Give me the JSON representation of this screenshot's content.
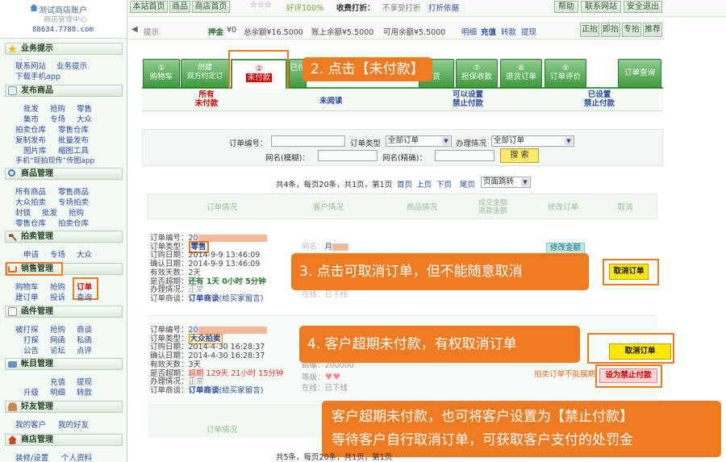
{
  "sidebar": {
    "logo_title": "测试商店账户",
    "logo_subtitle": "商店管理中心",
    "logo_url": "88634.7788.com",
    "sections": [
      {
        "title": "业务提示",
        "links": [
          "联系网站",
          "业务提示",
          "下载手机app"
        ]
      },
      {
        "title": "发布商品",
        "links": [
          "批发",
          "抢购",
          "零售",
          "集市",
          "专场",
          "大众",
          "拍卖仓库",
          "零售仓库",
          "复制发布",
          "批量发布",
          "图片库",
          "缩图工具",
          "手机“现拍现传”传图app"
        ]
      },
      {
        "title": "商品管理",
        "links": [
          "所有商品",
          "零售商品",
          "大众拍卖",
          "专场拍卖",
          "封锁",
          "批发",
          "抢购",
          "零售仓库",
          "拍卖仓库"
        ]
      },
      {
        "title": "拍卖管理",
        "links": [
          "申请",
          "专场",
          "大众"
        ]
      },
      {
        "title": "销售管理",
        "links": [
          "购物车",
          "抢购",
          "订单",
          "建订单",
          "投诉",
          "查询"
        ]
      },
      {
        "title": "函件管理",
        "links": [
          "被打探",
          "抢购",
          "商谈",
          "打探",
          "网函",
          "私函",
          "公告",
          "论坛",
          "点评"
        ]
      },
      {
        "title": "帐目管理",
        "links": [
          "充值",
          "提现",
          "升级",
          "明细",
          "转款"
        ]
      },
      {
        "title": "好友管理",
        "links": [
          "我的客户",
          "我的好友"
        ]
      },
      {
        "title": "商店管理",
        "links": [
          "装修/设置",
          "个人资料"
        ]
      }
    ]
  },
  "topbar": {
    "nav": [
      "本站首页",
      "商品",
      "商店首页"
    ],
    "stars": "☆☆☆",
    "rating": "好评100%",
    "collect_label": "收费打折：",
    "collect_value": "不享受打折",
    "collect_link": "打折依据",
    "right": [
      "帮助",
      "联系网站",
      "安全退出"
    ]
  },
  "infobar": {
    "tip": "提示",
    "deposit_label": "押金",
    "deposit_value": "¥0",
    "total": "总余额¥16.5000",
    "account": "账上余额¥5.5000",
    "avail": "可用余额¥5.5000",
    "links": [
      "明细",
      "充值",
      "转款",
      "提现"
    ],
    "right": [
      "正抬",
      "即抬",
      "专抬",
      "推荐"
    ]
  },
  "steps": [
    {
      "num": "①",
      "label": "购物车"
    },
    {
      "num": "",
      "label": "创建\n双方约定订"
    },
    {
      "num": "②",
      "label": "未付款"
    },
    {
      "num": "",
      "label": "已付款"
    },
    {
      "num": "",
      "label": "发货"
    },
    {
      "num": "⑦",
      "label": "担保收款"
    },
    {
      "num": "⑧",
      "label": "退货订单"
    },
    {
      "num": "⑨",
      "label": "订单评价"
    }
  ],
  "query_button": "订单查询",
  "subtabs": [
    "所有\n未付款",
    "未阅读",
    "可以设置\n禁止付款",
    "已设置\n禁止付款"
  ],
  "filter": {
    "order_no_label": "订单编号：",
    "type_label": "订单类型",
    "type_value": "全部订单",
    "status_label": "办理情况",
    "status_value": "全部订单",
    "fuzzy_label": "网名(模糊)：",
    "exact_label": "网名(精确)：",
    "search_button": "搜 索"
  },
  "pagination": {
    "summary": "共4条，每页20条，共1页，第1页",
    "links": [
      "首页",
      "上页",
      "下页",
      "尾页"
    ],
    "jump": "页面跳转"
  },
  "pagination_bottom": "共5条，每页20条，共1页，第1页",
  "table_headers": [
    "订单情况",
    "客户情况",
    "商品情况",
    "成交金额\n退款金额",
    "修改订单",
    "取消"
  ],
  "orders": [
    {
      "no_label": "订单编号：",
      "no_prefix": "20",
      "type_label": "订单类型：",
      "type": "零售",
      "order_date": "订购日期：2014-9-9 13:46:09",
      "confirm_date": "确认日期：2014-9-9 13:46:09",
      "days": "有效天数：2天",
      "overdue_label": "是否超期：",
      "overdue": "还有 1天 0小时 5分钟",
      "handle_label": "办理情况：",
      "handle": "正常",
      "talk_label": "订单商谈：",
      "talk_link": "订单商谈",
      "talk_hint": "(给买家留言)",
      "customer_label": "网名：",
      "customer_name": "月",
      "online_label": "在线：",
      "online": "已下线",
      "modify": "修改金额",
      "cancel": "取消订单"
    },
    {
      "no_label": "订单编号：",
      "no_prefix": "20",
      "type_label": "订单类型：",
      "type": "大众拍卖",
      "order_date": "订购日期：2014-4-30 16:28:37",
      "confirm_date": "确认日期：2014-4-30 16:28:37",
      "days": "有效天数：3天",
      "overdue_label": "是否超期：",
      "overdue": "超期 129天 21小时 15分钟",
      "handle_label": "办理情况：",
      "handle": "正常",
      "talk_label": "订单商谈：",
      "talk_link": "订单商谈",
      "talk_hint": "(给买家留言)",
      "zip": "邮编：200000",
      "level_label": "等级：",
      "online_label": "在线：",
      "online": "已下线",
      "cancel": "取消订单",
      "forbid_note": "拍卖订单不能展期",
      "forbid": "设为禁止付款"
    }
  ],
  "callouts": {
    "c2": "2. 点击【未付款】",
    "c3": "3. 点击可取消订单，但不能随意取消",
    "c4": "4. 客户超期未付款，有权取消订单",
    "c5_line1": "客户超期未付款，也可将客户设置为【禁止付款】",
    "c5_line2": "等待客户自行取消订单，可获取客户支付的处罚金"
  },
  "colors": {
    "accent": "#ee7b22",
    "tab_green": "#3f9a3f",
    "cancel_yellow": "#ffe800",
    "warn_red": "#e8321e"
  }
}
